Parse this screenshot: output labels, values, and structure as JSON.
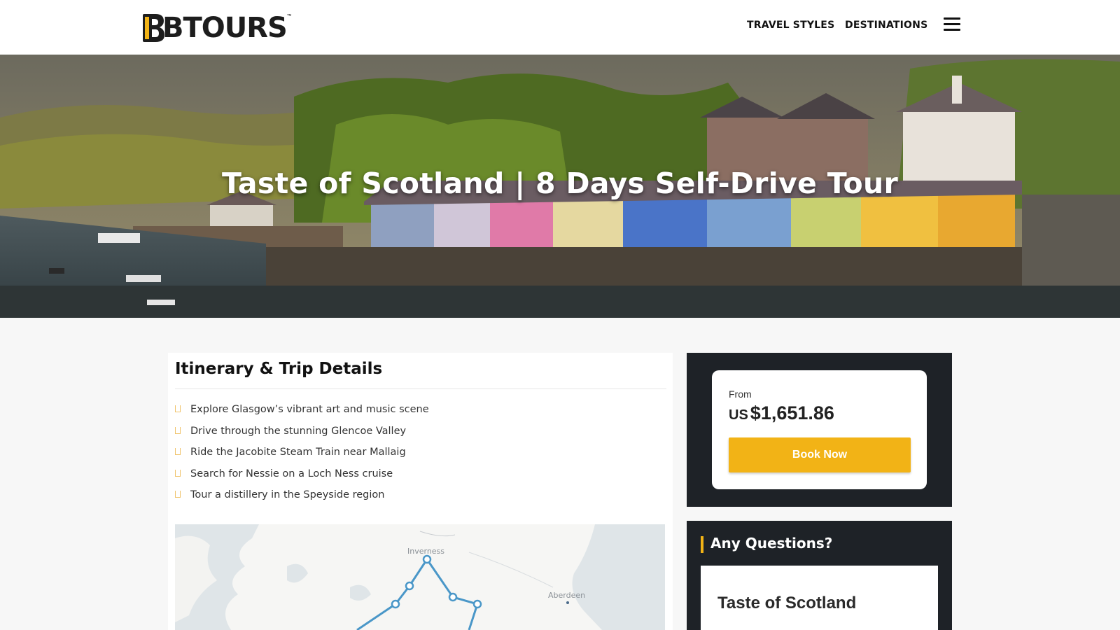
{
  "brand": {
    "logo_text": "BTOURS",
    "tm": "™",
    "logo_color": "#f2b316"
  },
  "nav": {
    "items": [
      {
        "label": "TRAVEL STYLES"
      },
      {
        "label": "DESTINATIONS"
      }
    ],
    "menu_icon": "hamburger-menu-icon"
  },
  "hero": {
    "title": "Taste of Scotland | 8 Days Self-Drive Tour",
    "image": "Harbour village with colorful houses on the waterfront"
  },
  "itinerary": {
    "title": "Itinerary & Trip Details",
    "highlights": [
      "Explore Glasgow’s vibrant art and music scene",
      "Drive through the stunning Glencoe Valley",
      "Ride the Jacobite Steam Train near Mallaig",
      "Search for Nessie on a Loch Ness cruise",
      "Tour a distillery in the Speyside region"
    ],
    "map": {
      "labels": {
        "inverness": "Inverness",
        "aberdeen": "Aberdeen"
      },
      "route_color": "#4a97c8"
    }
  },
  "booking": {
    "from_label": "From",
    "currency": "US",
    "price": "$1,651.86",
    "book_label": "Book Now",
    "accent_color": "#f2b316"
  },
  "questions": {
    "title": "Any Questions?",
    "card_title": "Taste of Scotland"
  }
}
